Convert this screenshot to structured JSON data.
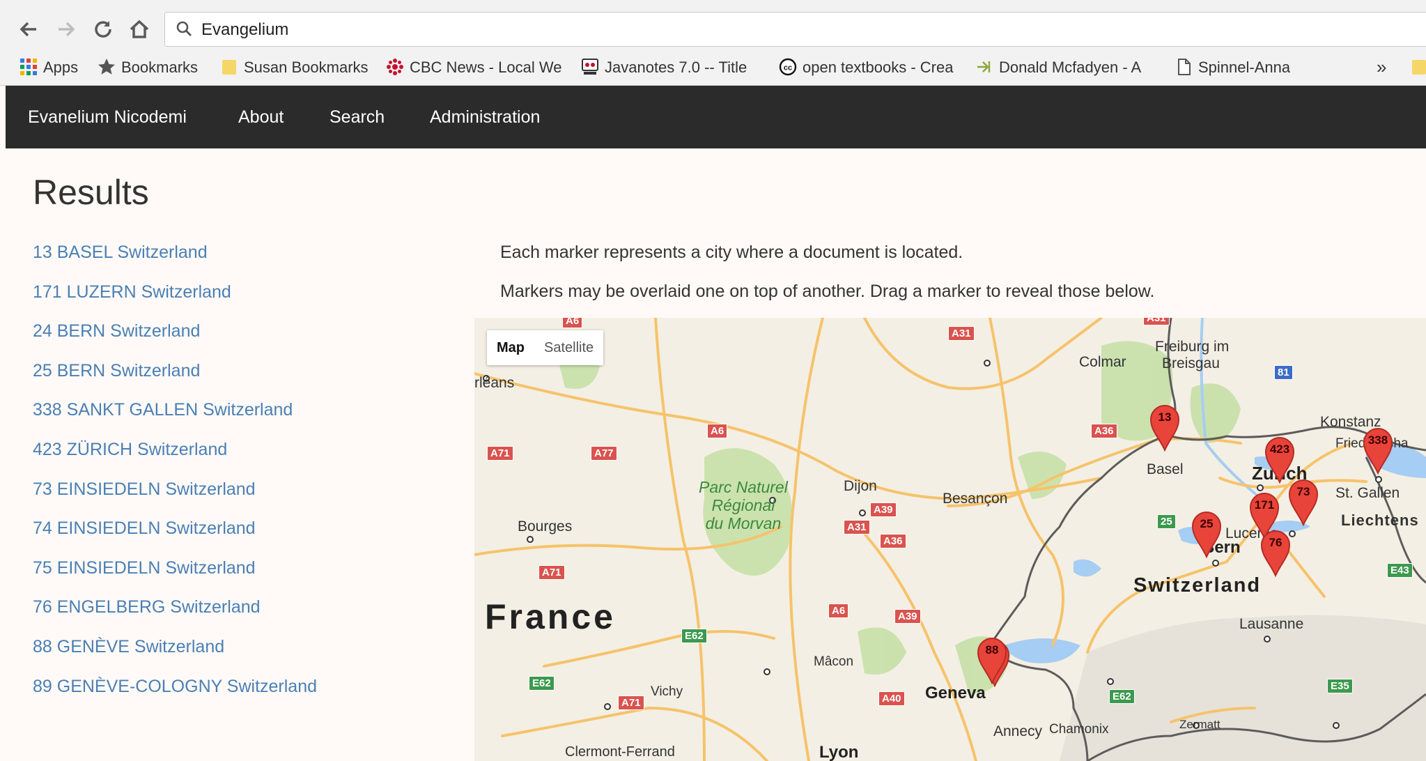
{
  "browser": {
    "address_value": "Evangelium",
    "bookmarks": [
      {
        "label": "Apps",
        "icon": "apps-grid-icon"
      },
      {
        "label": "Bookmarks",
        "icon": "star-icon"
      },
      {
        "label": "Susan Bookmarks",
        "icon": "folder-icon"
      },
      {
        "label": "CBC News - Local We",
        "icon": "cbc-logo-icon"
      },
      {
        "label": "Javanotes 7.0 -- Title",
        "icon": "javanotes-icon"
      },
      {
        "label": "open textbooks - Crea",
        "icon": "creative-commons-icon"
      },
      {
        "label": "Donald Mcfadyen - A",
        "icon": "arrow-logo-icon"
      },
      {
        "label": "Spinnel-Anna",
        "icon": "document-icon"
      }
    ],
    "overflow_label": "»"
  },
  "navbar": {
    "brand": "Evanelium Nicodemi",
    "links": [
      "About",
      "Search",
      "Administration"
    ]
  },
  "page": {
    "heading": "Results",
    "results": [
      "13 BASEL Switzerland",
      "171 LUZERN Switzerland",
      "24 BERN Switzerland",
      "25 BERN Switzerland",
      "338 SANKT GALLEN Switzerland",
      "423 ZÜRICH Switzerland",
      "73 EINSIEDELN Switzerland",
      "74 EINSIEDELN Switzerland",
      "75 EINSIEDELN Switzerland",
      "76 ENGELBERG Switzerland",
      "88 GENÈVE Switzerland",
      "89 GENÈVE-COLOGNY Switzerland"
    ],
    "info_line_1": "Each marker represents a city where a document is located.",
    "info_line_2": "Markers may be overlaid one on top of another. Drag a marker to reveal those below."
  },
  "map": {
    "type_control": [
      "Map",
      "Satellite"
    ],
    "active_type": "Map",
    "country_labels": {
      "france": "France",
      "switzerland": "Switzerland"
    },
    "park_label": [
      "Parc Naturel",
      "Régional",
      "du Morvan"
    ],
    "cities": [
      "rléans",
      "Bourges",
      "Dijon",
      "Besançon",
      "Colmar",
      "Freiburg im",
      "Breisgau",
      "Basel",
      "Zurich",
      "Konstanz",
      "St. Gallen",
      "Liechtens",
      "Lucerne",
      "Bern",
      "Lausanne",
      "Geneva",
      "Annecy",
      "Chamonix",
      "Zermatt",
      "Mâcon",
      "Vichy",
      "Clermont-Ferrand",
      "Lyon",
      "Friedrichsha"
    ],
    "highways": [
      "A6",
      "A31",
      "A36",
      "A71",
      "A77",
      "A6",
      "A39",
      "A31",
      "A36",
      "A71",
      "A6",
      "A39",
      "E62",
      "E62",
      "A71",
      "A40",
      "E62",
      "E35",
      "E43",
      "81",
      "A31",
      "25"
    ],
    "markers": [
      "13",
      "423",
      "338",
      "73",
      "171",
      "76",
      "25",
      "88"
    ],
    "colors": {
      "land": "#f4efe4",
      "water": "#a6cdf3",
      "forest": "#c6e0a8",
      "road": "#f6c36b",
      "marker": "#e8443a",
      "border": "#5c5c5c"
    }
  }
}
